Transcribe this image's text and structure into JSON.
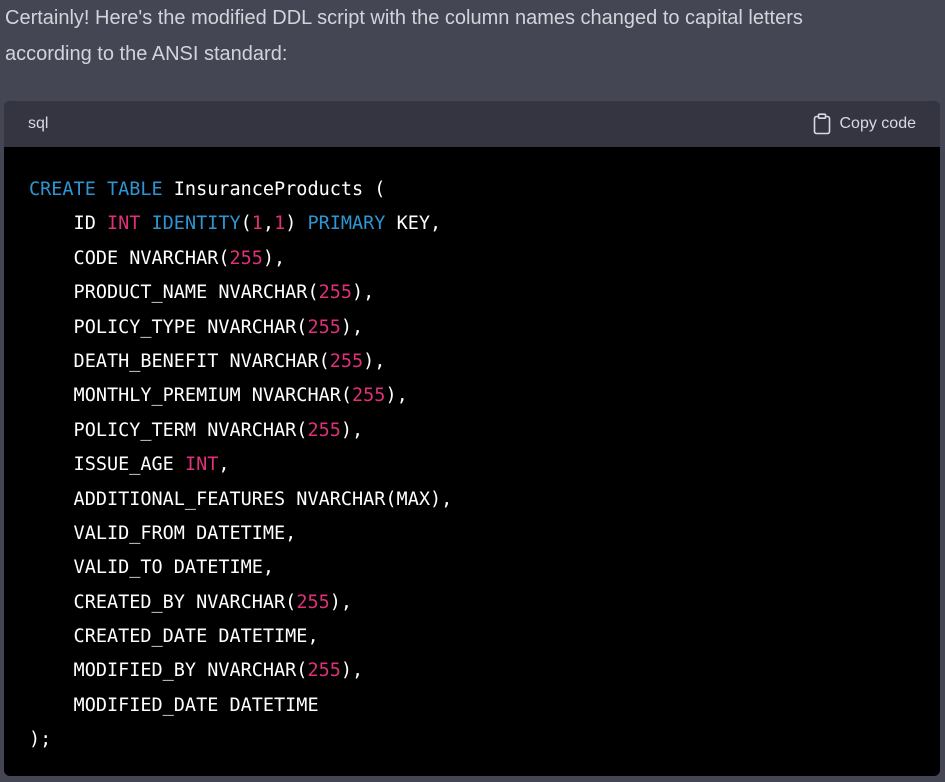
{
  "message": {
    "intro_line1": "Certainly! Here's the modified DDL script with the column names changed to capital letters",
    "intro_line2": "according to the ANSI standard:"
  },
  "code_block": {
    "language": "sql",
    "copy_label": "Copy code",
    "icons": {
      "copy": "clipboard-icon"
    },
    "colors": {
      "keyword": "#2e95d3",
      "number": "#df3079",
      "plain": "#ffffff",
      "background": "#000000",
      "header": "#343541"
    },
    "lines": [
      [
        {
          "t": "CREATE TABLE",
          "c": "kw"
        },
        {
          "t": " InsuranceProducts (",
          "c": "plain"
        }
      ],
      [
        {
          "t": "    ID ",
          "c": "plain"
        },
        {
          "t": "INT",
          "c": "type"
        },
        {
          "t": " ",
          "c": "plain"
        },
        {
          "t": "IDENTITY",
          "c": "kw"
        },
        {
          "t": "(",
          "c": "plain"
        },
        {
          "t": "1",
          "c": "num"
        },
        {
          "t": ",",
          "c": "plain"
        },
        {
          "t": "1",
          "c": "num"
        },
        {
          "t": ") ",
          "c": "plain"
        },
        {
          "t": "PRIMARY",
          "c": "kw"
        },
        {
          "t": " KEY,",
          "c": "plain"
        }
      ],
      [
        {
          "t": "    CODE NVARCHAR(",
          "c": "plain"
        },
        {
          "t": "255",
          "c": "num"
        },
        {
          "t": "),",
          "c": "plain"
        }
      ],
      [
        {
          "t": "    PRODUCT_NAME NVARCHAR(",
          "c": "plain"
        },
        {
          "t": "255",
          "c": "num"
        },
        {
          "t": "),",
          "c": "plain"
        }
      ],
      [
        {
          "t": "    POLICY_TYPE NVARCHAR(",
          "c": "plain"
        },
        {
          "t": "255",
          "c": "num"
        },
        {
          "t": "),",
          "c": "plain"
        }
      ],
      [
        {
          "t": "    DEATH_BENEFIT NVARCHAR(",
          "c": "plain"
        },
        {
          "t": "255",
          "c": "num"
        },
        {
          "t": "),",
          "c": "plain"
        }
      ],
      [
        {
          "t": "    MONTHLY_PREMIUM NVARCHAR(",
          "c": "plain"
        },
        {
          "t": "255",
          "c": "num"
        },
        {
          "t": "),",
          "c": "plain"
        }
      ],
      [
        {
          "t": "    POLICY_TERM NVARCHAR(",
          "c": "plain"
        },
        {
          "t": "255",
          "c": "num"
        },
        {
          "t": "),",
          "c": "plain"
        }
      ],
      [
        {
          "t": "    ISSUE_AGE ",
          "c": "plain"
        },
        {
          "t": "INT",
          "c": "type"
        },
        {
          "t": ",",
          "c": "plain"
        }
      ],
      [
        {
          "t": "    ADDITIONAL_FEATURES NVARCHAR(MAX),",
          "c": "plain"
        }
      ],
      [
        {
          "t": "    VALID_FROM DATETIME,",
          "c": "plain"
        }
      ],
      [
        {
          "t": "    VALID_TO DATETIME,",
          "c": "plain"
        }
      ],
      [
        {
          "t": "    CREATED_BY NVARCHAR(",
          "c": "plain"
        },
        {
          "t": "255",
          "c": "num"
        },
        {
          "t": "),",
          "c": "plain"
        }
      ],
      [
        {
          "t": "    CREATED_DATE DATETIME,",
          "c": "plain"
        }
      ],
      [
        {
          "t": "    MODIFIED_BY NVARCHAR(",
          "c": "plain"
        },
        {
          "t": "255",
          "c": "num"
        },
        {
          "t": "),",
          "c": "plain"
        }
      ],
      [
        {
          "t": "    MODIFIED_DATE DATETIME",
          "c": "plain"
        }
      ],
      [
        {
          "t": ");",
          "c": "plain"
        }
      ]
    ]
  }
}
